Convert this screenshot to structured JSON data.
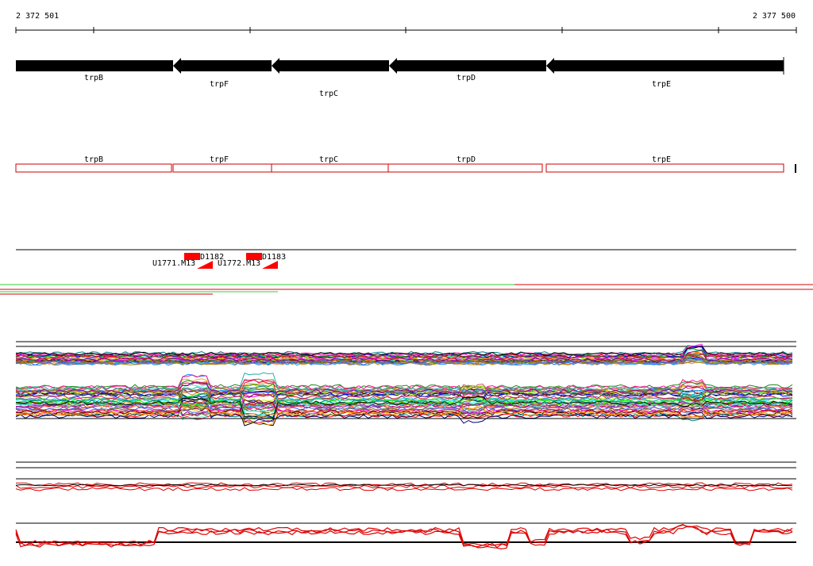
{
  "ruler": {
    "start_label": "2 372 501",
    "end_label": "2 377 500"
  },
  "genes": [
    {
      "name": "trpB"
    },
    {
      "name": "trpF"
    },
    {
      "name": "trpC"
    },
    {
      "name": "trpD"
    },
    {
      "name": "trpE"
    }
  ],
  "cds": [
    {
      "name": "trpB"
    },
    {
      "name": "trpF"
    },
    {
      "name": "trpC"
    },
    {
      "name": "trpD"
    },
    {
      "name": "trpE"
    }
  ],
  "probes": [
    {
      "name": "D1182",
      "clone": "U1771.M13"
    },
    {
      "name": "D1183",
      "clone": "U1772.M13"
    }
  ],
  "colors": {
    "gene_arrow": "#000000",
    "cds_outline": "#cc0000",
    "probe_fill": "#ff0000",
    "green_track": "#33cc33",
    "red_track": "#dd0000",
    "black": "#000000"
  }
}
